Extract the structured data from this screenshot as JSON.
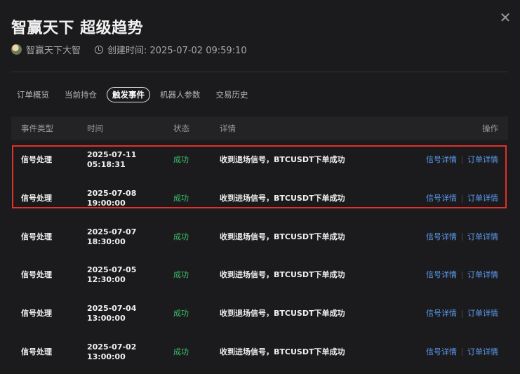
{
  "header": {
    "title": "智赢天下 超级趋势",
    "author": "智赢天下大智",
    "created": "创建时间: 2025-07-02 09:59:10"
  },
  "tabs": [
    "订单概览",
    "当前持仓",
    "触发事件",
    "机器人参数",
    "交易历史"
  ],
  "active_tab": "触发事件",
  "table": {
    "columns": [
      "事件类型",
      "时间",
      "状态",
      "详情",
      "操作"
    ],
    "rows": [
      {
        "type": "信号处理",
        "date": "2025-07-11",
        "time": "05:18:31",
        "status": "成功",
        "detail": "收到退场信号，BTCUSDT下单成功",
        "action1": "信号详情",
        "action2": "订单详情"
      },
      {
        "type": "信号处理",
        "date": "2025-07-08",
        "time": "19:00:00",
        "status": "成功",
        "detail": "收到进场信号，BTCUSDT下单成功",
        "action1": "信号详情",
        "action2": "订单详情"
      },
      {
        "type": "信号处理",
        "date": "2025-07-07",
        "time": "18:30:00",
        "status": "成功",
        "detail": "收到退场信号，BTCUSDT下单成功",
        "action1": "信号详情",
        "action2": "订单详情"
      },
      {
        "type": "信号处理",
        "date": "2025-07-05",
        "time": "12:30:00",
        "status": "成功",
        "detail": "收到进场信号，BTCUSDT下单成功",
        "action1": "信号详情",
        "action2": "订单详情"
      },
      {
        "type": "信号处理",
        "date": "2025-07-04",
        "time": "13:00:00",
        "status": "成功",
        "detail": "收到退场信号，BTCUSDT下单成功",
        "action1": "信号详情",
        "action2": "订单详情"
      },
      {
        "type": "信号处理",
        "date": "2025-07-02",
        "time": "13:00:00",
        "status": "成功",
        "detail": "收到进场信号，BTCUSDT下单成功",
        "action1": "信号详情",
        "action2": "订单详情"
      }
    ]
  },
  "colors": {
    "background": "#1b1b1d",
    "success": "#3dbd6a",
    "link": "#5b9bf0",
    "highlight": "#e0312b"
  }
}
